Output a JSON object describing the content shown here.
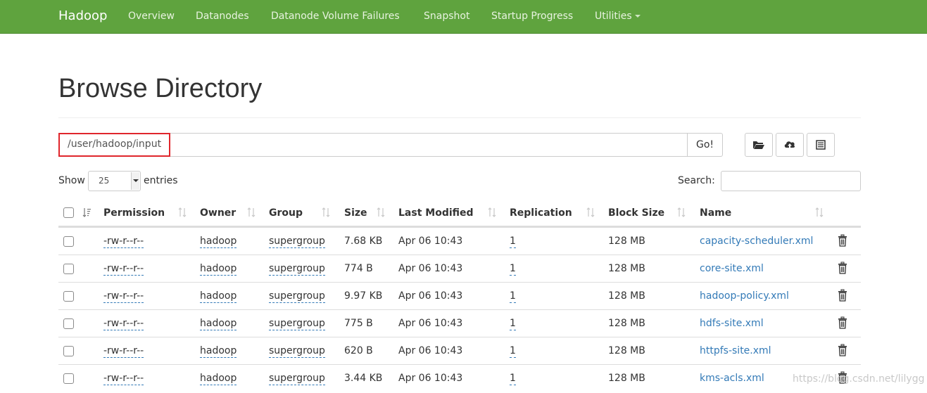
{
  "navbar": {
    "brand": "Hadoop",
    "items": [
      "Overview",
      "Datanodes",
      "Datanode Volume Failures",
      "Snapshot",
      "Startup Progress",
      "Utilities"
    ]
  },
  "page": {
    "title": "Browse Directory",
    "path": "/user/hadoop/input",
    "go_label": "Go!"
  },
  "toolbar": {
    "icons": [
      "folder-open-icon",
      "cloud-upload-icon",
      "list-icon"
    ]
  },
  "controls": {
    "show_label": "Show",
    "entries_value": "25",
    "entries_label": "entries",
    "search_label": "Search:",
    "search_value": ""
  },
  "table": {
    "columns": [
      "Permission",
      "Owner",
      "Group",
      "Size",
      "Last Modified",
      "Replication",
      "Block Size",
      "Name"
    ],
    "rows": [
      {
        "permission": "-rw-r--r--",
        "owner": "hadoop",
        "group": "supergroup",
        "size": "7.68 KB",
        "modified": "Apr 06 10:43",
        "replication": "1",
        "block_size": "128 MB",
        "name": "capacity-scheduler.xml"
      },
      {
        "permission": "-rw-r--r--",
        "owner": "hadoop",
        "group": "supergroup",
        "size": "774 B",
        "modified": "Apr 06 10:43",
        "replication": "1",
        "block_size": "128 MB",
        "name": "core-site.xml"
      },
      {
        "permission": "-rw-r--r--",
        "owner": "hadoop",
        "group": "supergroup",
        "size": "9.97 KB",
        "modified": "Apr 06 10:43",
        "replication": "1",
        "block_size": "128 MB",
        "name": "hadoop-policy.xml"
      },
      {
        "permission": "-rw-r--r--",
        "owner": "hadoop",
        "group": "supergroup",
        "size": "775 B",
        "modified": "Apr 06 10:43",
        "replication": "1",
        "block_size": "128 MB",
        "name": "hdfs-site.xml"
      },
      {
        "permission": "-rw-r--r--",
        "owner": "hadoop",
        "group": "supergroup",
        "size": "620 B",
        "modified": "Apr 06 10:43",
        "replication": "1",
        "block_size": "128 MB",
        "name": "httpfs-site.xml"
      },
      {
        "permission": "-rw-r--r--",
        "owner": "hadoop",
        "group": "supergroup",
        "size": "3.44 KB",
        "modified": "Apr 06 10:43",
        "replication": "1",
        "block_size": "128 MB",
        "name": "kms-acls.xml"
      }
    ]
  },
  "watermark": "https://blog.csdn.net/lilygg",
  "colors": {
    "navbar": "#5fa33e",
    "link": "#337ab7",
    "highlight": "#e0262c"
  }
}
